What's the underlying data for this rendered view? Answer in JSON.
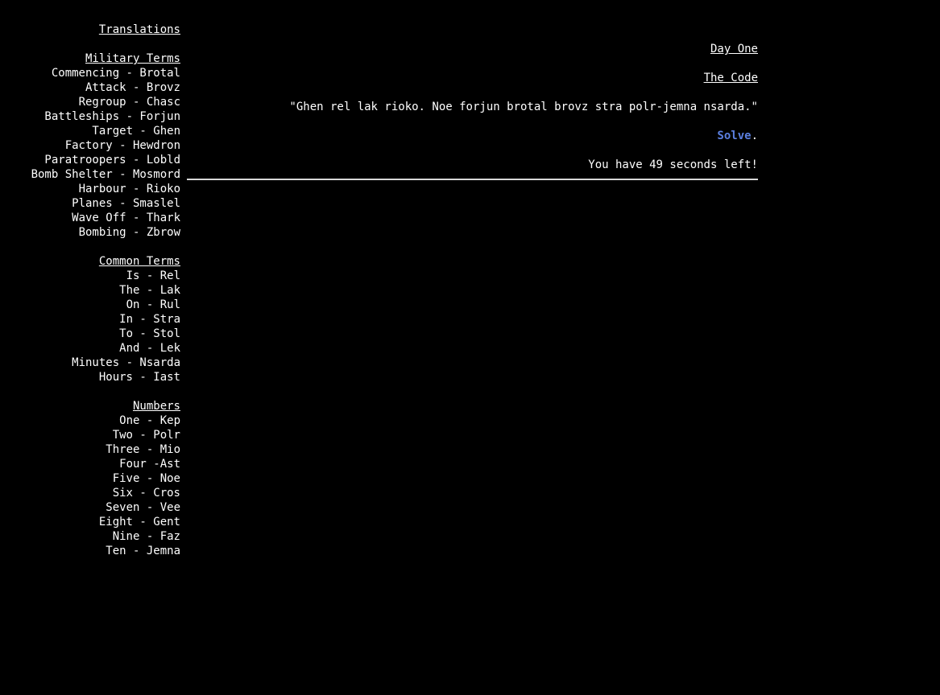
{
  "sidebar": {
    "title": "Translations",
    "sections": [
      {
        "heading": "Military Terms",
        "terms": [
          "Commencing - Brotal",
          "Attack - Brovz",
          "Regroup - Chasc",
          "Battleships - Forjun",
          "Target - Ghen",
          "Factory - Hewdron",
          "Paratroopers - Lobld",
          "Bomb Shelter - Mosmord",
          "Harbour - Rioko",
          "Planes - Smaslel",
          "Wave Off - Thark",
          "Bombing - Zbrow"
        ]
      },
      {
        "heading": "Common Terms",
        "terms": [
          "Is - Rel",
          "The - Lak",
          "On - Rul",
          "In - Stra",
          "To - Stol",
          "And - Lek",
          "Minutes - Nsarda",
          "Hours - Iast"
        ]
      },
      {
        "heading": "Numbers",
        "terms": [
          "One - Kep",
          "Two - Polr",
          "Three - Mio",
          "Four -Ast",
          "Five - Noe",
          "Six - Cros",
          "Seven - Vee",
          "Eight - Gent",
          "Nine - Faz",
          "Ten - Jemna"
        ]
      }
    ]
  },
  "main": {
    "day": "Day One",
    "code_heading": "The Code",
    "code_text": "\"Ghen rel lak rioko. Noe forjun brotal brovz stra polr-jemna nsarda.\"",
    "solve_label": "Solve",
    "solve_suffix": ".",
    "timer_prefix": "You have ",
    "timer_seconds": "49",
    "timer_suffix": " seconds left!"
  },
  "colors": {
    "background": "#000000",
    "text": "#ffffff",
    "link": "#5b7fe0"
  }
}
